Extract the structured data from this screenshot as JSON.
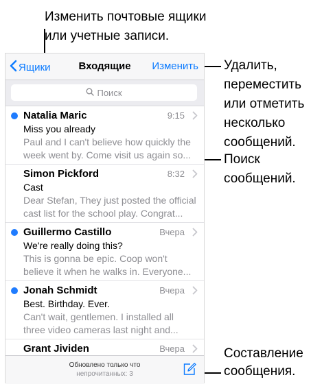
{
  "callouts": {
    "top_line1": "Изменить почтовые ящики",
    "top_line2": "или учетные записи.",
    "edit_lines": [
      "Удалить,",
      "переместить",
      "или отметить",
      "несколько",
      "сообщений."
    ],
    "search_lines": [
      "Поиск",
      "сообщений."
    ],
    "compose_lines": [
      "Составление",
      "сообщения."
    ]
  },
  "nav": {
    "back_label": "Ящики",
    "title": "Входящие",
    "edit_label": "Изменить"
  },
  "search": {
    "placeholder": "Поиск"
  },
  "messages": [
    {
      "sender": "Natalia Maric",
      "time": "9:15",
      "subject": "Miss you already",
      "preview1": "Paul and I can't believe how quickly the",
      "preview2": "week went by. Come visit us again so...",
      "unread": true
    },
    {
      "sender": "Simon Pickford",
      "time": "8:32",
      "subject": "Cast",
      "preview1": "Dear Stefan, They just posted the official",
      "preview2": "cast list for the school play. Congrat...",
      "unread": false
    },
    {
      "sender": "Guillermo Castillo",
      "time": "Вчера",
      "subject": "We're really doing this?",
      "preview1": "This is gonna be epic. Coop won't",
      "preview2": "believe it when he walks in. Everyone...",
      "unread": true
    },
    {
      "sender": "Jonah Schmidt",
      "time": "Вчера",
      "subject": "Best. Birthday. Ever.",
      "preview1": "Can't wait, gentlemen. I installed all",
      "preview2": "three video cameras last night and...",
      "unread": true
    },
    {
      "sender": "Grant Jividen",
      "time": "Вчера",
      "subject": "",
      "preview1": "",
      "preview2": "",
      "unread": false
    }
  ],
  "toolbar": {
    "updated": "Обновлено только что",
    "unread": "непрочитанных: 3"
  },
  "colors": {
    "accent": "#0a7aff",
    "unread_dot": "#1f7cff"
  },
  "icons": {
    "back": "chevron-left-icon",
    "search": "magnifier-icon",
    "row": "chevron-right-icon",
    "compose": "compose-icon"
  }
}
